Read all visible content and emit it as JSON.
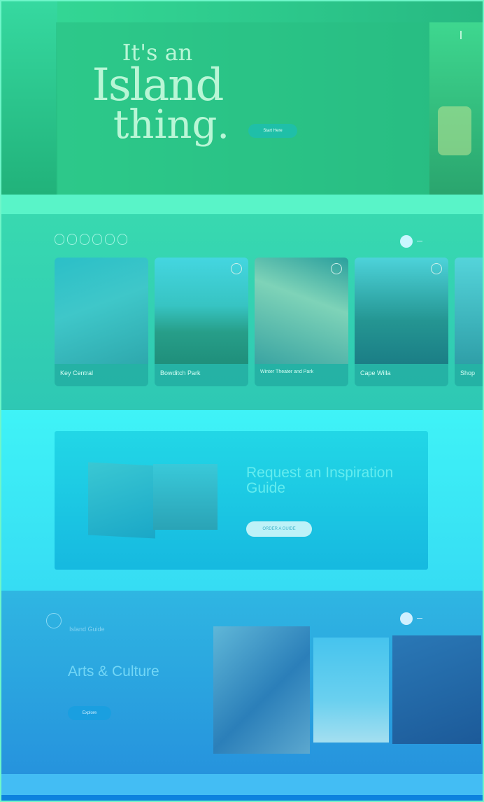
{
  "hero": {
    "tagline_1": "It's an",
    "tagline_2": "Island",
    "tagline_3": "thing.",
    "paragraph_1": "",
    "paragraph_2": "",
    "button": "Start Here"
  },
  "categories": {
    "chips": [
      "",
      "",
      "",
      "",
      "",
      ""
    ],
    "cards": [
      {
        "label": "Key Central"
      },
      {
        "label": "Bowditch Park"
      },
      {
        "label": "Winter Theater and Park"
      },
      {
        "label": "Cape Willa"
      },
      {
        "label": "Shop"
      }
    ]
  },
  "guide": {
    "title": "Request an Inspiration Guide",
    "text": "",
    "button": "ORDER A GUIDE"
  },
  "arts": {
    "subtitle": "Island Guide",
    "title": "Arts & Culture",
    "text": "",
    "button": "Explore"
  },
  "colors": {
    "accent_teal": "#1fbfa8",
    "guide_panel": "#16b9e0",
    "bottom_strip": "#0d82de"
  }
}
